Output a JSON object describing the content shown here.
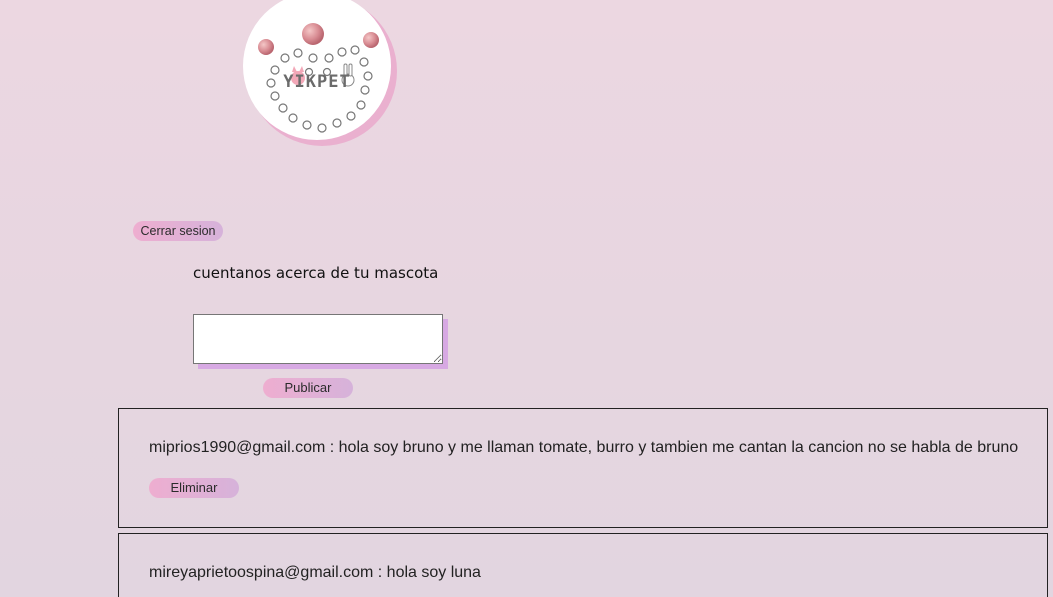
{
  "logo": {
    "text": "YIKPET"
  },
  "header": {
    "logout_label": "Cerrar sesion"
  },
  "composer": {
    "prompt": "cuentanos acerca de tu mascota",
    "textarea_value": "",
    "publish_label": "Publicar"
  },
  "posts": [
    {
      "author": "miprios1990@gmail.com",
      "separator": " : ",
      "text": "hola soy bruno y me llaman tomate, burro y tambien me cantan la cancion no se habla de bruno",
      "line": "miprios1990@gmail.com : hola soy bruno y me llaman tomate, burro y tambien me cantan la cancion no se habla de bruno",
      "delete_label": "Eliminar"
    },
    {
      "author": "mireyaprietoospina@gmail.com",
      "separator": " : ",
      "text": "hola soy luna",
      "line": "mireyaprietoospina@gmail.com : hola soy luna"
    }
  ],
  "colors": {
    "button_gradient_start": "#eeaed0",
    "button_gradient_end": "#d6b2da",
    "textarea_shadow": "#d7a9e3",
    "logo_shadow": "#eab0cf"
  }
}
